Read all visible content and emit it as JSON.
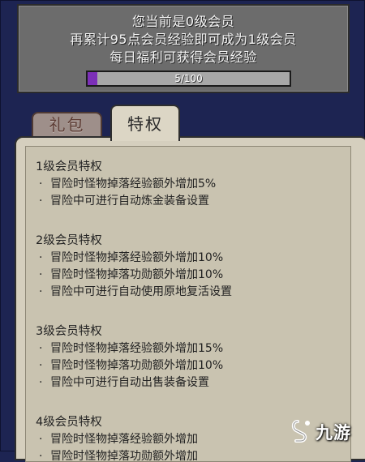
{
  "header": {
    "line1": "您当前是0级会员",
    "line2": "再累计95点会员经验即可成为1级会员",
    "line3": "每日福利可获得会员经验",
    "progress_text": "5/100",
    "progress_fraction": 0.05,
    "progress_color": "#7c2fb8"
  },
  "tabs": [
    {
      "label": "礼包",
      "active": false
    },
    {
      "label": "特权",
      "active": true
    }
  ],
  "levels": [
    {
      "title": "1级会员特权",
      "perks": [
        "冒险时怪物掉落经验额外增加5%",
        "冒险中可进行自动炼金装备设置"
      ]
    },
    {
      "title": "2级会员特权",
      "perks": [
        "冒险时怪物掉落经验额外增加10%",
        "冒险时怪物掉落功勋额外增加10%",
        "冒险中可进行自动使用原地复活设置"
      ]
    },
    {
      "title": "3级会员特权",
      "perks": [
        "冒险时怪物掉落经验额外增加15%",
        "冒险时怪物掉落功勋额外增加10%",
        "冒险中可进行自动出售装备设置"
      ]
    },
    {
      "title": "4级会员特权",
      "perks": [
        "冒险时怪物掉落经验额外增加",
        "冒险时怪物掉落功勋额外增加"
      ]
    }
  ],
  "bullet": "·",
  "watermark": {
    "text": "九游",
    "icon": "jiuyou-logo-icon"
  }
}
